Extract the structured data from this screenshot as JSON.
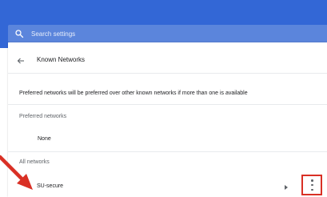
{
  "search": {
    "placeholder": "Search settings"
  },
  "header": {
    "title": "Known Networks"
  },
  "description": "Preferred networks will be preferred over other known networks if more than one is available",
  "preferred_section": {
    "label": "Preferred networks",
    "empty_text": "None"
  },
  "all_section": {
    "label": "All networks"
  },
  "networks": [
    {
      "name": "SU-secure"
    }
  ],
  "icons": {
    "search": "search-icon",
    "back": "back-arrow-icon",
    "chevron": "chevron-right-icon",
    "menu": "more-vertical-icon",
    "annotation": "red-arrow-annotation"
  },
  "colors": {
    "topbar": "#3367d6",
    "search_bg": "#5b85dc",
    "highlight": "#d93025"
  }
}
